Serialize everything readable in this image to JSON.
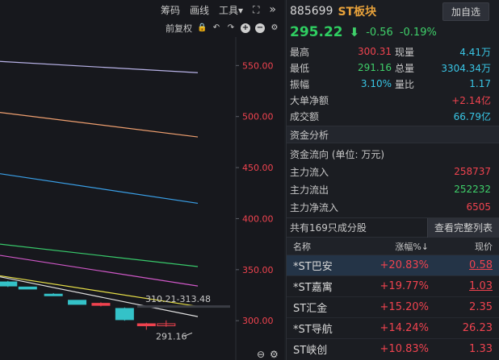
{
  "toolbar": {
    "chip_label": "筹码",
    "draw_label": "画线",
    "tools_label": "工具▾",
    "adjust_label": "前复权"
  },
  "chart_data": {
    "type": "line",
    "y_ticks": [
      "550.00",
      "500.00",
      "450.00",
      "400.00",
      "350.00",
      "300.00"
    ],
    "y_tick_values": [
      550,
      500,
      450,
      400,
      350,
      300
    ],
    "ylim": [
      282,
      570
    ],
    "series": [
      {
        "color": "#b9b3e8",
        "values": [
          [
            0,
            554
          ],
          [
            1,
            543
          ]
        ]
      },
      {
        "color": "#f0a070",
        "values": [
          [
            0,
            504
          ],
          [
            1,
            480
          ]
        ]
      },
      {
        "color": "#3aa0e8",
        "values": [
          [
            0,
            444
          ],
          [
            1,
            415
          ]
        ]
      },
      {
        "color": "#38c96b",
        "values": [
          [
            0,
            375
          ],
          [
            1,
            353
          ]
        ]
      },
      {
        "color": "#d058c8",
        "values": [
          [
            0,
            364
          ],
          [
            1,
            334
          ]
        ]
      },
      {
        "color": "#e8e048",
        "values": [
          [
            0,
            344
          ],
          [
            1,
            314
          ]
        ]
      },
      {
        "color": "#e0e0e0",
        "values": [
          [
            0,
            343
          ],
          [
            1,
            304
          ]
        ]
      }
    ],
    "candles": [
      {
        "x": 0.04,
        "open": 338,
        "close": 334,
        "high": 339,
        "low": 333,
        "color": "#34c2c8"
      },
      {
        "x": 0.14,
        "open": 333,
        "close": 331,
        "high": 333,
        "low": 331,
        "color": "#34c2c8"
      },
      {
        "x": 0.27,
        "open": 326,
        "close": 325,
        "high": 327,
        "low": 325,
        "color": "#34c2c8"
      },
      {
        "x": 0.39,
        "open": 320,
        "close": 316,
        "high": 320,
        "low": 316,
        "color": "#34c2c8"
      },
      {
        "x": 0.51,
        "open": 317,
        "close": 315,
        "high": 318,
        "low": 314,
        "color": "#f0434f"
      },
      {
        "x": 0.63,
        "open": 312,
        "close": 301,
        "high": 313,
        "low": 300,
        "color": "#34c2c8"
      },
      {
        "x": 0.74,
        "open": 297,
        "close": 295,
        "high": 298,
        "low": 291.16,
        "color": "#f0434f"
      },
      {
        "x": 0.84,
        "open": 295,
        "close": 297,
        "high": 300.31,
        "low": 294,
        "color": "#f0434f"
      }
    ],
    "annotations": [
      "310.21-313.48",
      "291.16"
    ]
  },
  "stock": {
    "code": "885699",
    "name": "ST板块",
    "add_label": "加自选",
    "price": "295.22",
    "change": "-0.56",
    "change_pct": "-0.19%"
  },
  "quote": {
    "high_label": "最高",
    "high": "300.31",
    "vol_label": "现量",
    "vol": "4.41万",
    "low_label": "最低",
    "low": "291.16",
    "total_label": "总量",
    "total": "3304.34万",
    "amp_label": "振幅",
    "amp": "3.10%",
    "ratio_label": "量比",
    "ratio": "1.17",
    "bignet_label": "大单净额",
    "bignet": "+2.14亿",
    "amount_label": "成交额",
    "amount": "66.79亿"
  },
  "flow": {
    "title": "资金分析",
    "unit": "资金流向 (单位: 万元)",
    "in_label": "主力流入",
    "in": "258737",
    "out_label": "主力流出",
    "out": "252232",
    "net_label": "主力净流入",
    "net": "6505"
  },
  "components": {
    "count": "共有169只成分股",
    "full_label": "查看完整列表",
    "col_name": "名称",
    "col_pct": "涨幅%↓",
    "col_price": "现价",
    "rows": [
      {
        "name": "*ST巴安",
        "pct": "+20.83%",
        "price": "0.58"
      },
      {
        "name": "*ST嘉寓",
        "pct": "+19.77%",
        "price": "1.03"
      },
      {
        "name": "ST汇金",
        "pct": "+15.20%",
        "price": "2.35"
      },
      {
        "name": "*ST导航",
        "pct": "+14.24%",
        "price": "26.23"
      },
      {
        "name": "ST峡创",
        "pct": "+10.83%",
        "price": "1.33"
      }
    ]
  }
}
